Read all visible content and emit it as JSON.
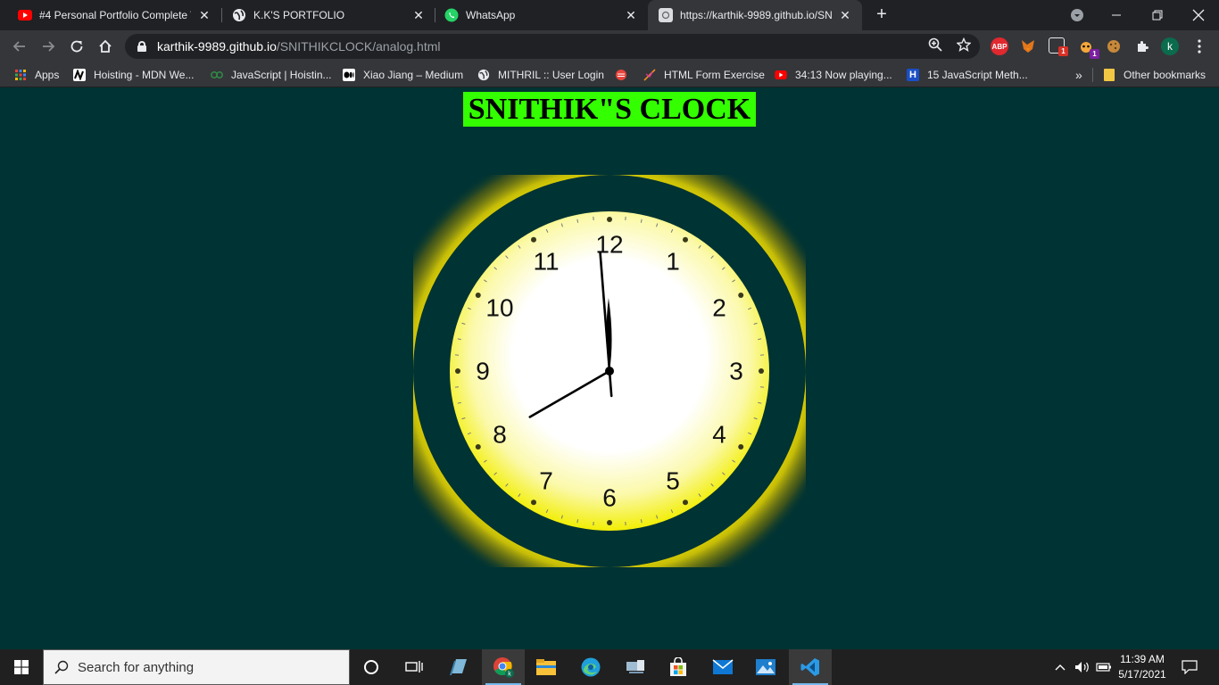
{
  "browser": {
    "tabs": [
      {
        "title": "#4 Personal Portfolio Complete W",
        "favicon": "youtube-icon"
      },
      {
        "title": "K.K'S PORTFOLIO",
        "favicon": "globe-icon"
      },
      {
        "title": "WhatsApp",
        "favicon": "whatsapp-icon"
      },
      {
        "title": "https://karthik-9989.github.io/SN",
        "favicon": "page-icon",
        "active": true
      }
    ],
    "url_host": "karthik-9989.github.io",
    "url_path": "/SNITHIKCLOCK/analog.html",
    "extension_badges": {
      "notifications": "1",
      "honey": "1"
    },
    "profile_initial": "k"
  },
  "bookmarks": {
    "items": [
      {
        "label": "Apps",
        "icon": "apps-grid-icon"
      },
      {
        "label": "Hoisting - MDN We...",
        "icon": "mdn-icon"
      },
      {
        "label": "JavaScript | Hoistin...",
        "icon": "gfg-icon"
      },
      {
        "label": "Xiao Jiang – Medium",
        "icon": "medium-icon"
      },
      {
        "label": "MITHRIL :: User Login",
        "icon": "globe-icon"
      },
      {
        "label": "",
        "icon": "red-circle-icon"
      },
      {
        "label": "HTML Form Exercise",
        "icon": "form-icon"
      },
      {
        "label": "34:13 Now playing...",
        "icon": "youtube-icon"
      },
      {
        "label": "15 JavaScript Meth...",
        "icon": "h-icon"
      }
    ],
    "overflow": "»",
    "other": "Other bookmarks"
  },
  "page": {
    "title": "SNITHIK\"S CLOCK",
    "clock": {
      "numerals": [
        "12",
        "1",
        "2",
        "3",
        "4",
        "5",
        "6",
        "7",
        "8",
        "9",
        "10",
        "11"
      ],
      "time": {
        "hours": 11,
        "minutes": 58.5,
        "seconds": 40
      },
      "colors": {
        "ring": "#003333",
        "glow": "#ffee00",
        "face_center": "#ffffff",
        "face_edge": "#f5f000",
        "hands": "#000000"
      }
    }
  },
  "taskbar": {
    "search_placeholder": "Search for anything",
    "time": "11:39 AM",
    "date": "5/17/2021",
    "apps": [
      "windows-icon",
      "cortana-icon",
      "task-view-icon",
      "notebook-icon",
      "chrome-icon",
      "file-explorer-icon",
      "edge-icon",
      "device-icon",
      "store-icon",
      "mail-icon",
      "photos-icon",
      "vscode-icon"
    ]
  }
}
